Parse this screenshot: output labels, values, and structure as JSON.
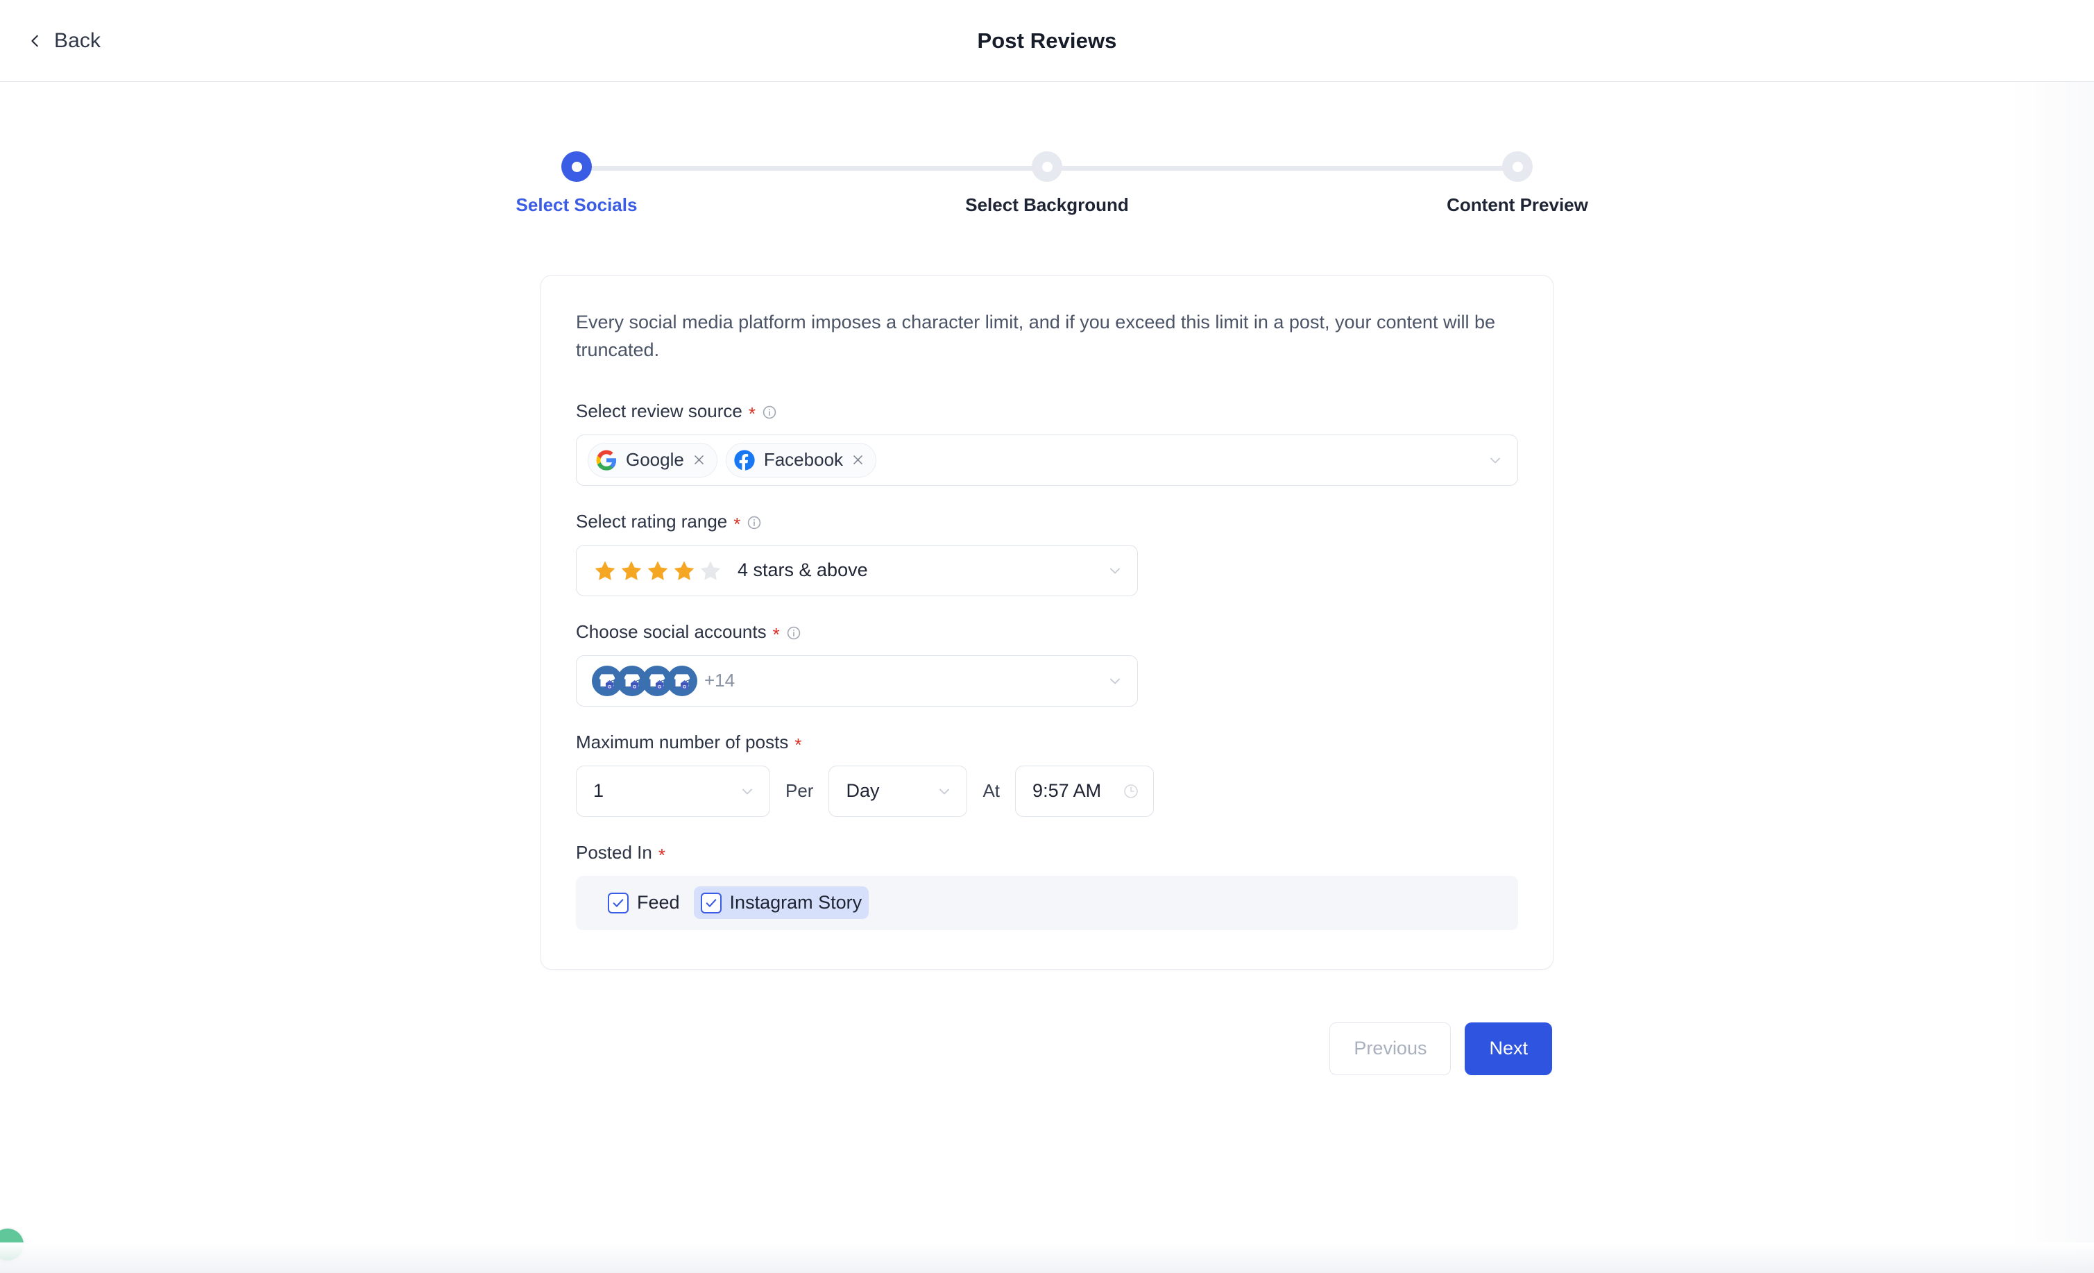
{
  "header": {
    "back_label": "Back",
    "title": "Post Reviews"
  },
  "stepper": {
    "steps": [
      {
        "label": "Select Socials",
        "state": "active"
      },
      {
        "label": "Select Background",
        "state": "upcoming"
      },
      {
        "label": "Content Preview",
        "state": "upcoming"
      }
    ]
  },
  "form": {
    "intro": "Every social media platform imposes a character limit, and if you exceed this limit in a post, your content will be truncated.",
    "review_source": {
      "label": "Select review source",
      "required": "*",
      "chips": [
        {
          "name": "Google",
          "icon": "google-icon"
        },
        {
          "name": "Facebook",
          "icon": "facebook-icon"
        }
      ]
    },
    "rating_range": {
      "label": "Select rating range",
      "required": "*",
      "value": "4 stars & above",
      "filled_stars": 4,
      "total_stars": 5
    },
    "social_accounts": {
      "label": "Choose social accounts",
      "required": "*",
      "visible_avatars": 4,
      "overflow_label": "+14"
    },
    "max_posts": {
      "label": "Maximum number of posts",
      "required": "*",
      "count_value": "1",
      "per_label": "Per",
      "per_value": "Day",
      "at_label": "At",
      "time_value": "9:57 AM"
    },
    "posted_in": {
      "label": "Posted In",
      "required": "*",
      "options": [
        {
          "label": "Feed",
          "checked": true,
          "focused": false
        },
        {
          "label": "Instagram Story",
          "checked": true,
          "focused": true
        }
      ]
    }
  },
  "actions": {
    "previous_label": "Previous",
    "next_label": "Next"
  },
  "colors": {
    "accent": "#3b5ce4",
    "primary_button": "#2f55e0",
    "required": "#d93025",
    "star_filled": "#f5a623",
    "star_empty": "#e6e8ec",
    "chat_bubble": "#5fc79a"
  }
}
